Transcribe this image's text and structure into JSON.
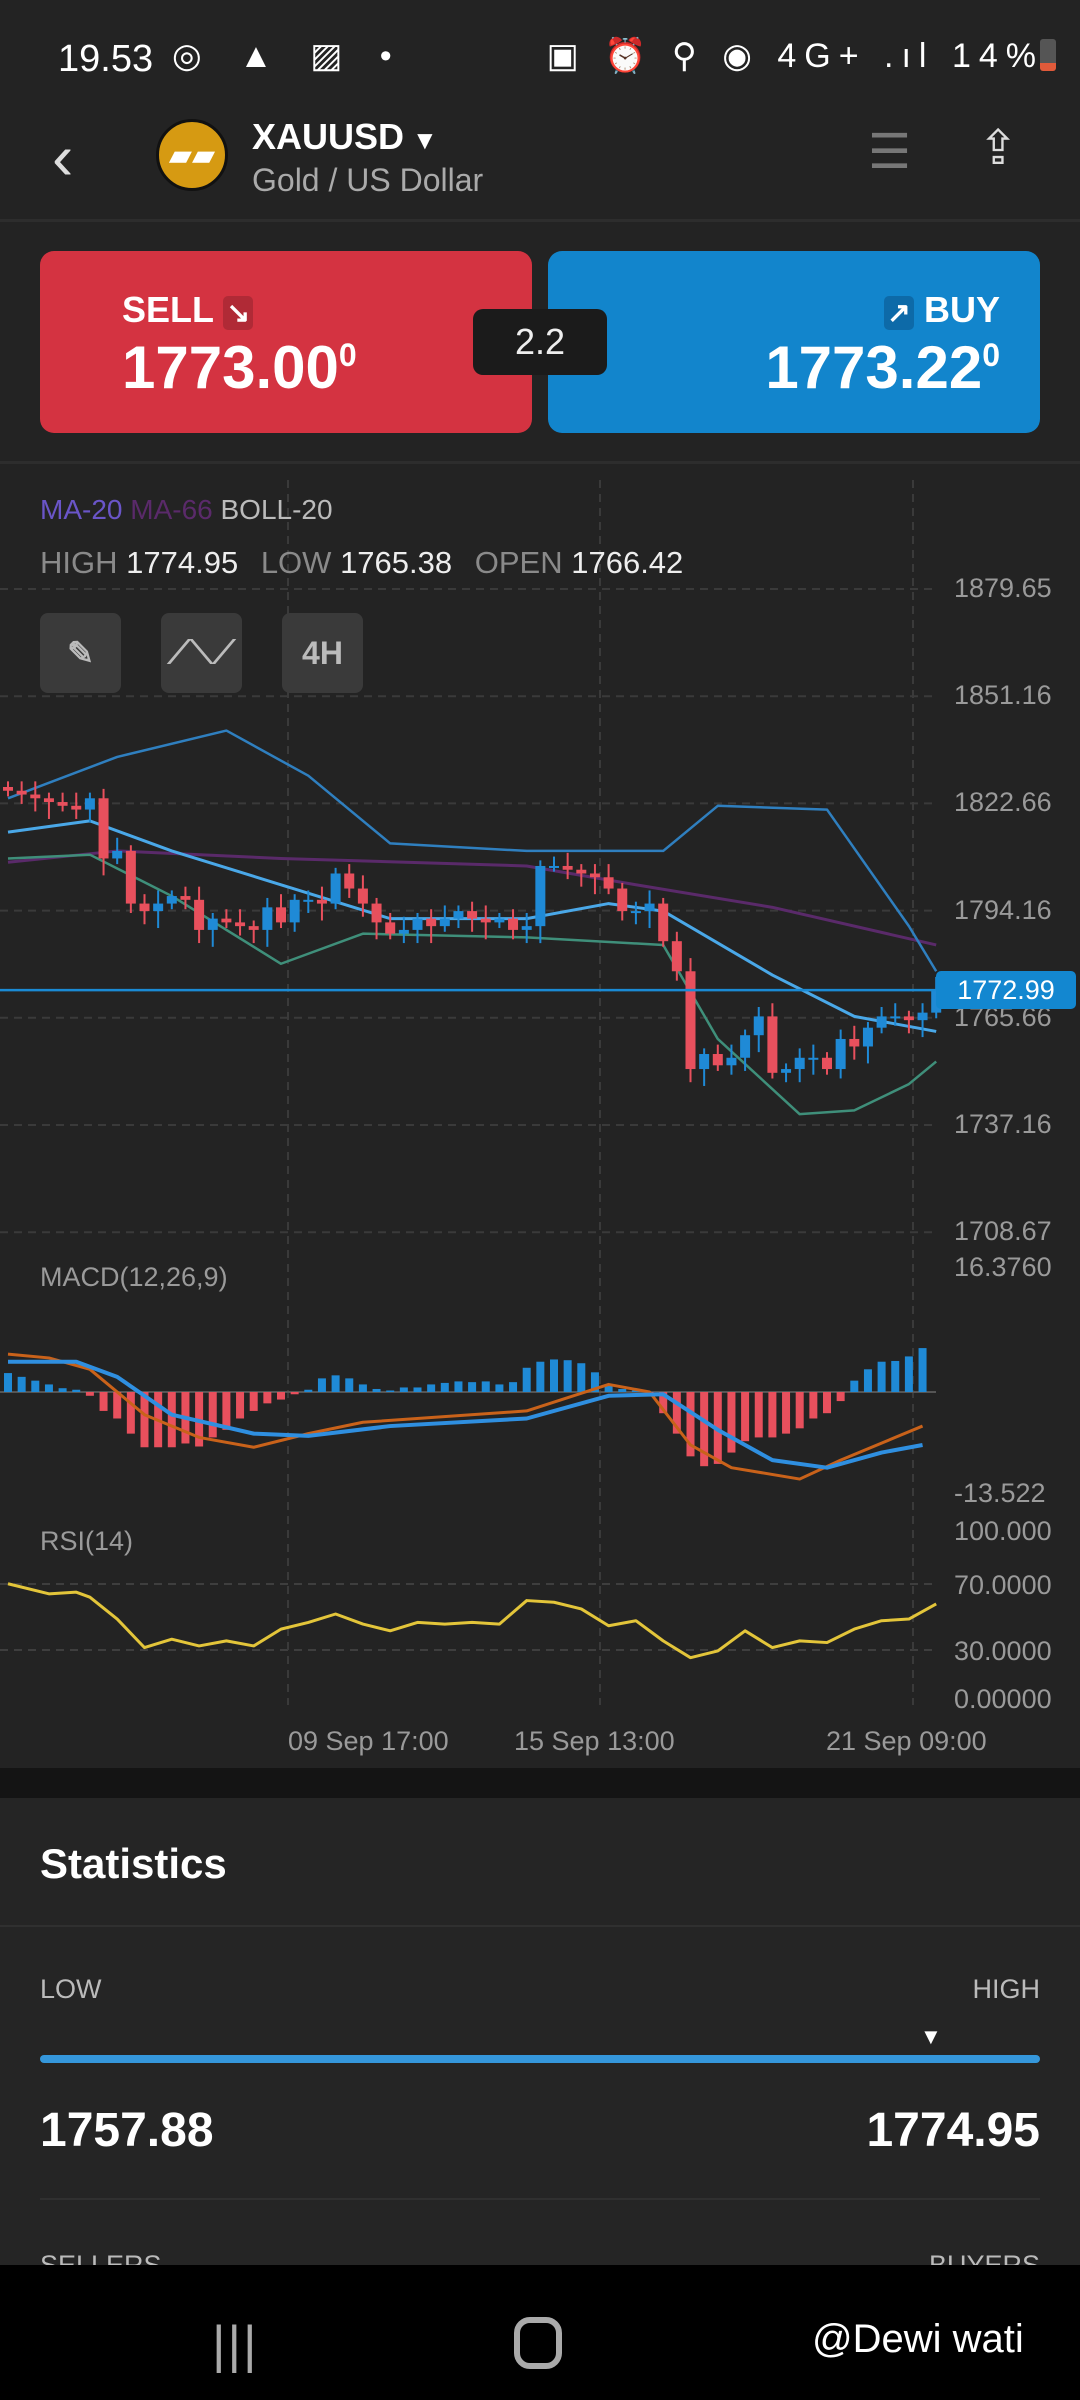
{
  "status_bar": {
    "time": "19.53",
    "left_icons": "◎ ▲ ▨ •",
    "right_icons": "▣ ⏰ ⚲ ◉ 4G+ .ıl",
    "battery": "14%"
  },
  "header": {
    "symbol": "XAUUSD",
    "name": "Gold / US Dollar",
    "logo_icon": "gold-bars"
  },
  "trade": {
    "sell_label": "SELL",
    "sell_price": "1773.00",
    "sell_sup": "0",
    "buy_label": "BUY",
    "buy_price": "1773.22",
    "buy_sup": "0",
    "spread": "2.2",
    "sell_arrow": "↘",
    "buy_arrow": "↗"
  },
  "chart": {
    "legend": {
      "ma20": "MA-20",
      "ma66": "MA-66",
      "boll": "BOLL-20"
    },
    "ohlc": {
      "high_label": "HIGH",
      "high": "1774.95",
      "low_label": "LOW",
      "low": "1765.38",
      "open_label": "OPEN",
      "open": "1766.42"
    },
    "timeframe": "4H",
    "price_ticks": [
      "1879.65",
      "1851.16",
      "1822.66",
      "1794.16",
      "1765.66",
      "1737.16",
      "1708.67"
    ],
    "current_price": "1772.99",
    "macd_label": "MACD(12,26,9)",
    "macd_max": "16.3760",
    "macd_min": "-13.522",
    "rsi_label": "RSI(14)",
    "rsi_ticks": [
      "100.000",
      "70.0000",
      "30.0000",
      "0.00000"
    ],
    "dates": [
      "09 Sep  17:00",
      "15 Sep  13:00",
      "21 Sep  09:00"
    ],
    "colors": {
      "up": "#1f8ad6",
      "down": "#e8505d",
      "boll_upper": "#2f7fbf",
      "boll_mid": "#4aa8e8",
      "boll_lower": "#3f8f7a",
      "ma66": "#5a2a6a",
      "macd": "#2f8fe0",
      "signal": "#c9621a",
      "rsi": "#e3c53a"
    }
  },
  "chart_data": {
    "type": "candlestick",
    "price_range": [
      1708.67,
      1879.65
    ],
    "closes": [
      1826,
      1825,
      1824,
      1823,
      1822,
      1821,
      1824,
      1808,
      1810,
      1796,
      1794,
      1796,
      1798,
      1797,
      1789,
      1792,
      1791,
      1790,
      1789,
      1795,
      1791,
      1797,
      1797,
      1796,
      1804,
      1800,
      1796,
      1791,
      1788,
      1789,
      1792,
      1790,
      1792,
      1794,
      1792,
      1791,
      1792,
      1789,
      1790,
      1806,
      1806,
      1805,
      1804,
      1803,
      1800,
      1794,
      1794,
      1796,
      1786,
      1778,
      1752,
      1756,
      1753,
      1755,
      1761,
      1766,
      1751,
      1752,
      1755,
      1755,
      1752,
      1760,
      1758,
      1763,
      1766,
      1766,
      1765,
      1767,
      1773
    ],
    "boll_upper": [
      [
        0,
        1824
      ],
      [
        8,
        1835
      ],
      [
        16,
        1842
      ],
      [
        22,
        1830
      ],
      [
        28,
        1812
      ],
      [
        38,
        1810
      ],
      [
        48,
        1810
      ],
      [
        52,
        1822
      ],
      [
        60,
        1821
      ],
      [
        66,
        1790
      ],
      [
        68,
        1778
      ]
    ],
    "boll_mid": [
      [
        0,
        1815
      ],
      [
        6,
        1818
      ],
      [
        12,
        1810
      ],
      [
        20,
        1801
      ],
      [
        28,
        1792
      ],
      [
        38,
        1792
      ],
      [
        44,
        1796
      ],
      [
        48,
        1794
      ],
      [
        56,
        1777
      ],
      [
        62,
        1766
      ],
      [
        68,
        1762
      ]
    ],
    "boll_lower": [
      [
        0,
        1808
      ],
      [
        6,
        1809
      ],
      [
        12,
        1798
      ],
      [
        20,
        1780
      ],
      [
        26,
        1788
      ],
      [
        38,
        1787
      ],
      [
        48,
        1785
      ],
      [
        52,
        1760
      ],
      [
        58,
        1740
      ],
      [
        62,
        1741
      ],
      [
        66,
        1748
      ],
      [
        68,
        1754
      ]
    ],
    "ma66": [
      [
        0,
        1807
      ],
      [
        8,
        1810
      ],
      [
        20,
        1808
      ],
      [
        38,
        1806
      ],
      [
        46,
        1801
      ],
      [
        56,
        1795
      ],
      [
        68,
        1785
      ]
    ],
    "macd_range": [
      -13.522,
      16.376
    ],
    "macd_hist": [
      2.5,
      2,
      1.5,
      1,
      0.5,
      0.3,
      -0.5,
      -2.5,
      -3.5,
      -5.5,
      -7.3,
      -7.3,
      -7.3,
      -6.8,
      -7.2,
      -6,
      -5,
      -3.5,
      -2.5,
      -1.5,
      -1,
      -0.3,
      0.3,
      1.8,
      2.2,
      1.8,
      1,
      0.4,
      0.2,
      0.6,
      0.6,
      1,
      1.2,
      1.4,
      1.3,
      1.4,
      1,
      1.3,
      3.2,
      4,
      4.3,
      4.2,
      3.8,
      2.6,
      1,
      0.4,
      0.2,
      -0.5,
      -2.8,
      -5.5,
      -8.5,
      -9.8,
      -9.5,
      -8,
      -6.5,
      -6,
      -6,
      -5.5,
      -4.8,
      -3.5,
      -2.8,
      -1.2,
      1.5,
      3,
      4,
      4.1,
      4.7,
      5.8
    ],
    "macd_line": [
      [
        0,
        4
      ],
      [
        5,
        4
      ],
      [
        8,
        2
      ],
      [
        12,
        -3
      ],
      [
        18,
        -5.5
      ],
      [
        22,
        -5.8
      ],
      [
        28,
        -4.5
      ],
      [
        38,
        -3.5
      ],
      [
        44,
        -0.5
      ],
      [
        48,
        -0.3
      ],
      [
        52,
        -5
      ],
      [
        56,
        -9
      ],
      [
        60,
        -10
      ],
      [
        64,
        -8
      ],
      [
        67,
        -7
      ]
    ],
    "signal_line": [
      [
        0,
        5
      ],
      [
        3,
        4.5
      ],
      [
        6,
        3
      ],
      [
        10,
        -3
      ],
      [
        14,
        -6
      ],
      [
        18,
        -7.3
      ],
      [
        22,
        -5.5
      ],
      [
        26,
        -4
      ],
      [
        38,
        -2.5
      ],
      [
        44,
        1
      ],
      [
        47,
        0
      ],
      [
        50,
        -7
      ],
      [
        53,
        -10
      ],
      [
        58,
        -11.5
      ],
      [
        61,
        -9
      ],
      [
        65,
        -6
      ],
      [
        67,
        -4.5
      ]
    ],
    "rsi": [
      [
        0,
        68
      ],
      [
        3,
        62
      ],
      [
        5,
        63
      ],
      [
        6,
        60
      ],
      [
        8,
        47
      ],
      [
        10,
        30
      ],
      [
        12,
        35
      ],
      [
        14,
        31
      ],
      [
        16,
        34
      ],
      [
        18,
        31
      ],
      [
        20,
        41
      ],
      [
        22,
        45
      ],
      [
        24,
        50
      ],
      [
        26,
        44
      ],
      [
        28,
        40
      ],
      [
        30,
        45
      ],
      [
        32,
        44
      ],
      [
        34,
        45
      ],
      [
        36,
        44
      ],
      [
        38,
        58
      ],
      [
        40,
        57
      ],
      [
        42,
        53
      ],
      [
        44,
        43
      ],
      [
        46,
        46
      ],
      [
        48,
        34
      ],
      [
        50,
        24
      ],
      [
        52,
        28
      ],
      [
        54,
        40
      ],
      [
        56,
        30
      ],
      [
        58,
        34
      ],
      [
        60,
        33
      ],
      [
        62,
        41
      ],
      [
        64,
        46
      ],
      [
        66,
        47
      ],
      [
        68,
        56
      ]
    ]
  },
  "statistics": {
    "title": "Statistics",
    "low_label": "LOW",
    "high_label": "HIGH",
    "low": "1757.88",
    "high": "1774.95",
    "current_fraction": 0.89,
    "sellers_label": "SELLERS",
    "buyers_label": "BUYERS"
  },
  "watermark": "@Dewi wati"
}
